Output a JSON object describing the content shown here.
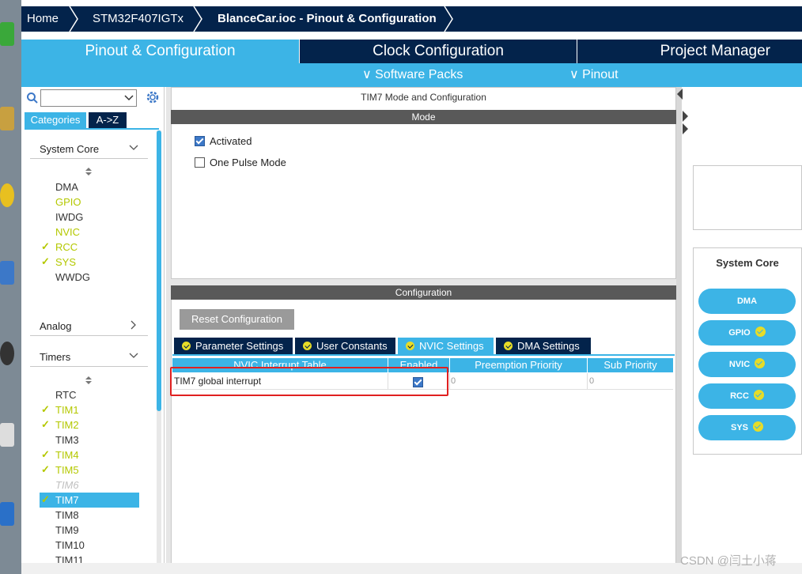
{
  "breadcrumb": {
    "home": "Home",
    "device": "STM32F407IGTx",
    "file": "BlanceCar.ioc - Pinout & Configuration"
  },
  "main_tabs": [
    "Pinout & Configuration",
    "Clock Configuration",
    "Project Manager"
  ],
  "sub_menu": [
    "Software Packs",
    "Pinout"
  ],
  "left_panel": {
    "search_value": "",
    "tabs": [
      "Categories",
      "A->Z"
    ],
    "system_core": {
      "title": "System Core",
      "items": [
        {
          "label": "DMA",
          "checked": false,
          "color": "normal"
        },
        {
          "label": "GPIO",
          "checked": false,
          "color": "yellow"
        },
        {
          "label": "IWDG",
          "checked": false,
          "color": "normal"
        },
        {
          "label": "NVIC",
          "checked": false,
          "color": "yellow"
        },
        {
          "label": "RCC",
          "checked": true,
          "color": "yellow"
        },
        {
          "label": "SYS",
          "checked": true,
          "color": "yellow"
        },
        {
          "label": "WWDG",
          "checked": false,
          "color": "normal"
        }
      ]
    },
    "analog": {
      "title": "Analog"
    },
    "timers": {
      "title": "Timers",
      "items": [
        {
          "label": "RTC",
          "checked": false,
          "color": "normal"
        },
        {
          "label": "TIM1",
          "checked": true,
          "color": "yellow"
        },
        {
          "label": "TIM2",
          "checked": true,
          "color": "yellow"
        },
        {
          "label": "TIM3",
          "checked": false,
          "color": "normal"
        },
        {
          "label": "TIM4",
          "checked": true,
          "color": "yellow"
        },
        {
          "label": "TIM5",
          "checked": true,
          "color": "yellow"
        },
        {
          "label": "TIM6",
          "checked": false,
          "color": "disabled"
        },
        {
          "label": "TIM7",
          "checked": true,
          "color": "selected"
        },
        {
          "label": "TIM8",
          "checked": false,
          "color": "normal"
        },
        {
          "label": "TIM9",
          "checked": false,
          "color": "normal"
        },
        {
          "label": "TIM10",
          "checked": false,
          "color": "normal"
        },
        {
          "label": "TIM11",
          "checked": false,
          "color": "normal"
        }
      ]
    }
  },
  "mode_panel": {
    "title": "TIM7 Mode and Configuration",
    "mode_header": "Mode",
    "activated_label": "Activated",
    "activated": true,
    "one_pulse_label": "One Pulse Mode",
    "one_pulse": false
  },
  "config_panel": {
    "header": "Configuration",
    "reset_button": "Reset Configuration",
    "tabs": [
      "Parameter Settings",
      "User Constants",
      "NVIC Settings",
      "DMA Settings"
    ],
    "active_tab": "NVIC Settings",
    "table": {
      "columns": [
        "NVIC Interrupt Table",
        "Enabled",
        "Preemption Priority",
        "Sub Priority"
      ],
      "rows": [
        {
          "name": "TIM7 global interrupt",
          "enabled": true,
          "preemption": "0",
          "sub": "0"
        }
      ]
    }
  },
  "right_panel": {
    "title": "System Core",
    "pills": [
      {
        "label": "DMA",
        "ok": false
      },
      {
        "label": "GPIO",
        "ok": true
      },
      {
        "label": "NVIC",
        "ok": true
      },
      {
        "label": "RCC",
        "ok": true
      },
      {
        "label": "SYS",
        "ok": true
      }
    ]
  },
  "watermark": "CSDN @闫土小蒋",
  "colors": {
    "navy": "#03234b",
    "accent_blue": "#3cb4e6",
    "ok_yellow": "#e6dc28",
    "highlight_red": "#e02020"
  }
}
